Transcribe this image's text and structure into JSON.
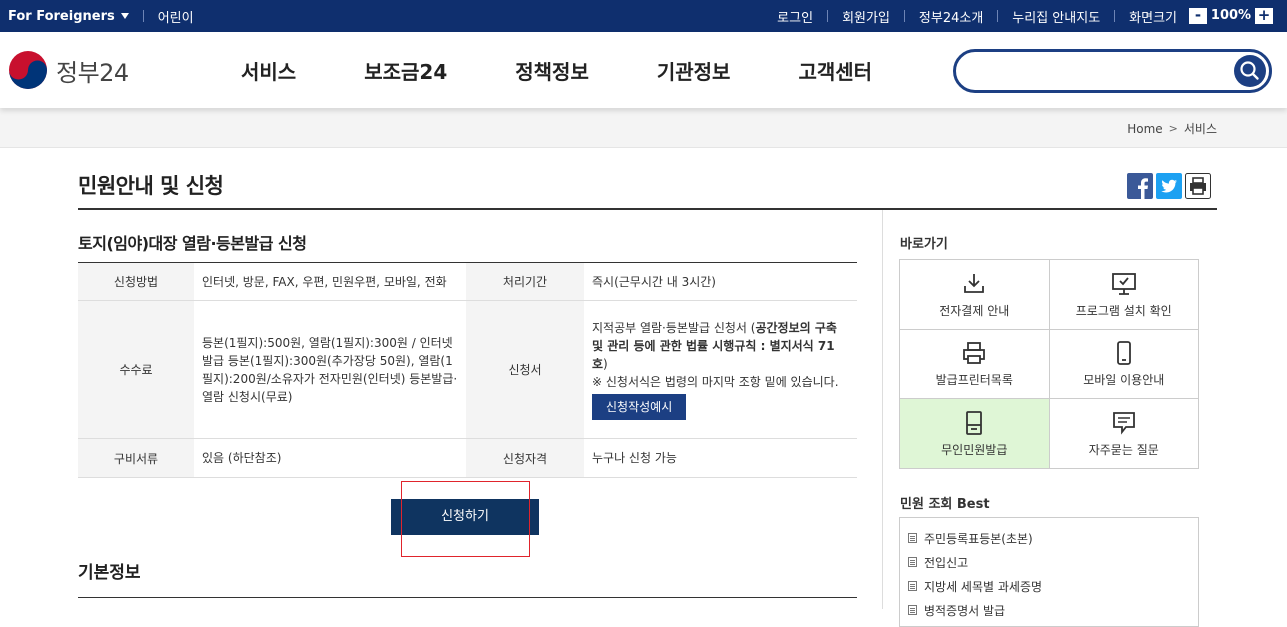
{
  "topbar": {
    "foreigners": "For Foreigners",
    "kids": "어린이",
    "links": [
      "로그인",
      "회원가입",
      "정부24소개",
      "누리집 안내지도",
      "화면크기"
    ],
    "zoom_minus": "-",
    "zoom_value": "100%",
    "zoom_plus": "+"
  },
  "header": {
    "logo_text": "정부24",
    "menu": [
      "서비스",
      "보조금24",
      "정책정보",
      "기관정보",
      "고객센터"
    ],
    "search_value": ""
  },
  "breadcrumb": {
    "home": "Home",
    "sep": ">",
    "current": "서비스"
  },
  "page": {
    "title": "민원안내 및 신청",
    "sub_title": "토지(임야)대장 열람·등본발급 신청",
    "basic_title": "기본정보"
  },
  "table": {
    "method_label": "신청방법",
    "method_value": "인터넷, 방문, FAX, 우편, 민원우편, 모바일, 전화",
    "period_label": "처리기간",
    "period_value": "즉시(근무시간 내 3시간)",
    "fee_label": "수수료",
    "fee_value": "등본(1필지):500원, 열람(1필지):300원 / 인터넷발급 등본(1필지):300원(추가장당 50원), 열람(1필지):200원/소유자가 전자민원(인터넷) 등본발급·열람 신청시(무료)",
    "form_label": "신청서",
    "form_value_1": "지적공부 열람·등본발급 신청서 (",
    "form_value_bold": "공간정보의 구축 및 관리 등에 관한 법률 시행규칙 : 별지서식 71호",
    "form_value_2": ")",
    "form_note": "※ 신청서식은 법령의 마지막 조항 밑에 있습니다.",
    "form_example": "신청작성예시",
    "docs_label": "구비서류",
    "docs_value": "있음 (하단참조)",
    "qual_label": "신청자격",
    "qual_value": "누구나 신청 가능"
  },
  "apply_button": "신청하기",
  "sidebar": {
    "quick_title": "바로가기",
    "quick_items": [
      "전자결제 안내",
      "프로그램 설치 확인",
      "발급프린터목록",
      "모바일 이용안내",
      "무인민원발급",
      "자주묻는 질문"
    ],
    "best_title": "민원 조회 Best",
    "best_items": [
      "주민등록표등본(초본)",
      "전입신고",
      "지방세 세목별 과세증명",
      "병적증명서 발급"
    ]
  },
  "colors": {
    "navy": "#0f2f6e",
    "button": "#0f3460",
    "highlight": "#e0242c",
    "active_cell": "#dff6d6"
  }
}
